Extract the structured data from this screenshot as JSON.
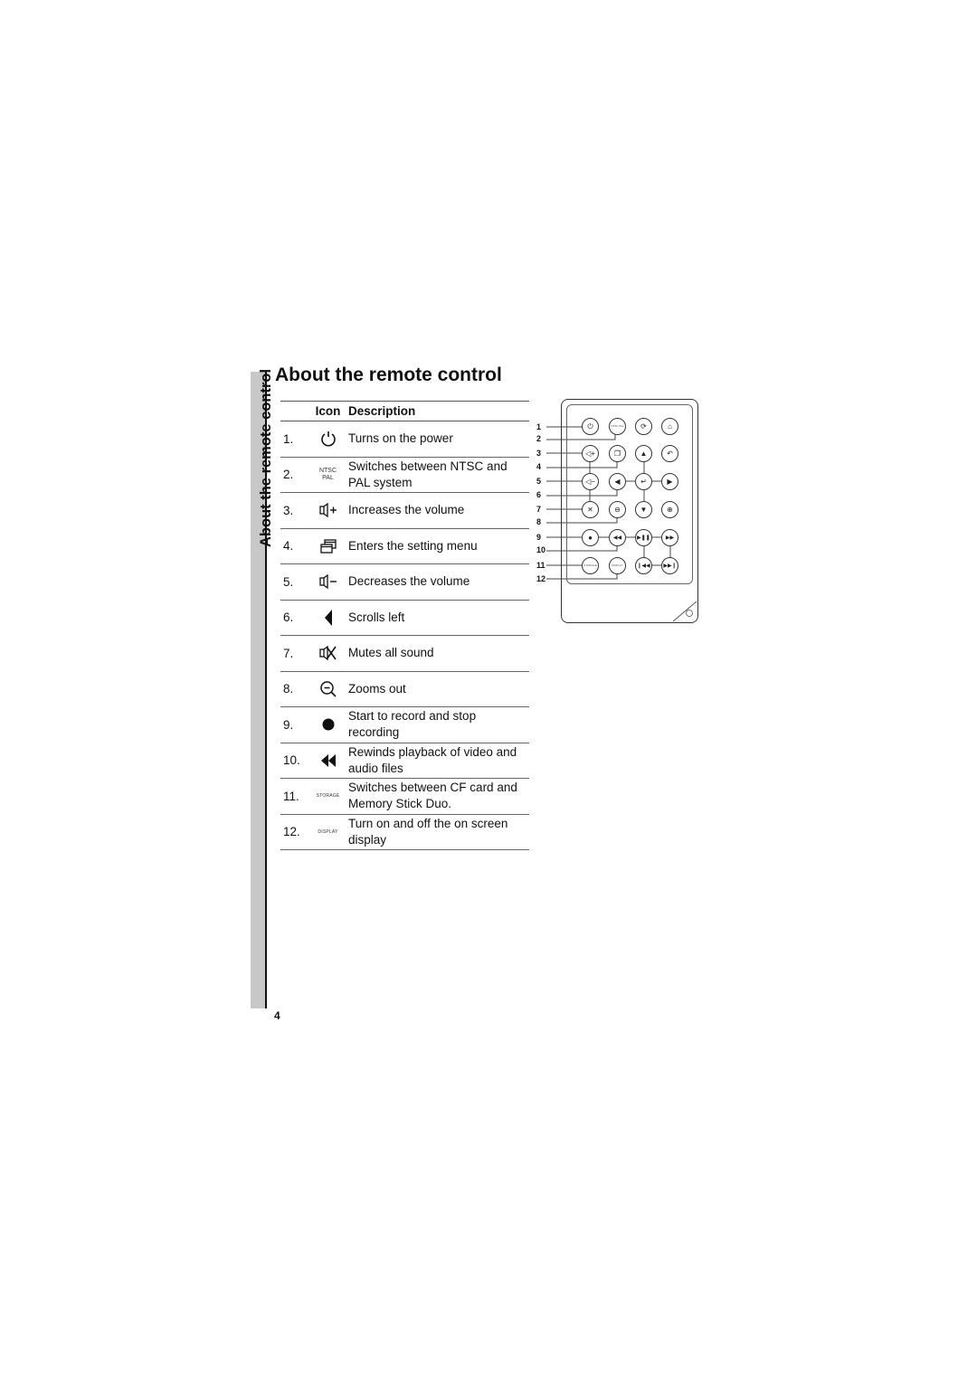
{
  "page": {
    "side_label": "About the remote control",
    "title": "About the remote control",
    "page_number": "4"
  },
  "table": {
    "headers": {
      "icon": "Icon",
      "description": "Description"
    },
    "rows": [
      {
        "num": "1.",
        "icon": "power-icon",
        "description": "Turns on the power"
      },
      {
        "num": "2.",
        "icon": "ntsc-pal-icon",
        "icon_text": [
          "NTSC",
          "PAL"
        ],
        "description": "Switches between NTSC and PAL system"
      },
      {
        "num": "3.",
        "icon": "volume-up-icon",
        "description": "Increases the volume"
      },
      {
        "num": "4.",
        "icon": "setting-menu-icon",
        "description": "Enters the setting menu"
      },
      {
        "num": "5.",
        "icon": "volume-down-icon",
        "description": "Decreases the volume"
      },
      {
        "num": "6.",
        "icon": "scroll-left-icon",
        "description": "Scrolls left"
      },
      {
        "num": "7.",
        "icon": "mute-icon",
        "description": "Mutes all sound"
      },
      {
        "num": "8.",
        "icon": "zoom-out-icon",
        "description": "Zooms out"
      },
      {
        "num": "9.",
        "icon": "record-icon",
        "description": "Start to record and stop recording"
      },
      {
        "num": "10.",
        "icon": "rewind-icon",
        "description": "Rewinds playback of video and audio files"
      },
      {
        "num": "11.",
        "icon": "storage-icon",
        "icon_text": "STORAGE",
        "description": "Switches between CF card and Memory Stick Duo."
      },
      {
        "num": "12.",
        "icon": "display-icon",
        "icon_text": "DISPLAY",
        "description": "Turn on and off the on screen display"
      }
    ]
  },
  "remote": {
    "callouts": [
      "1",
      "2",
      "3",
      "4",
      "5",
      "6",
      "7",
      "8",
      "9",
      "10",
      "11",
      "12"
    ],
    "buttons": {
      "power": "⏻",
      "ntsc_pal": "NTSC PAL",
      "rotate": "⟳",
      "home": "⌂",
      "vol_up": "◁+",
      "menu": "❐",
      "up": "▲",
      "back": "↶",
      "vol_down": "◁−",
      "left": "◀",
      "enter": "↵",
      "right": "▶",
      "mute": "✕",
      "zoom_out": "⊖",
      "down": "▼",
      "zoom_in": "⊕",
      "record": "●",
      "rewind": "◀◀",
      "play_pause": "▶❚❚",
      "forward": "▶▶",
      "storage": "STORAGE",
      "display": "DISPLAY",
      "prev": "❙◀◀",
      "next": "▶▶❙"
    }
  }
}
